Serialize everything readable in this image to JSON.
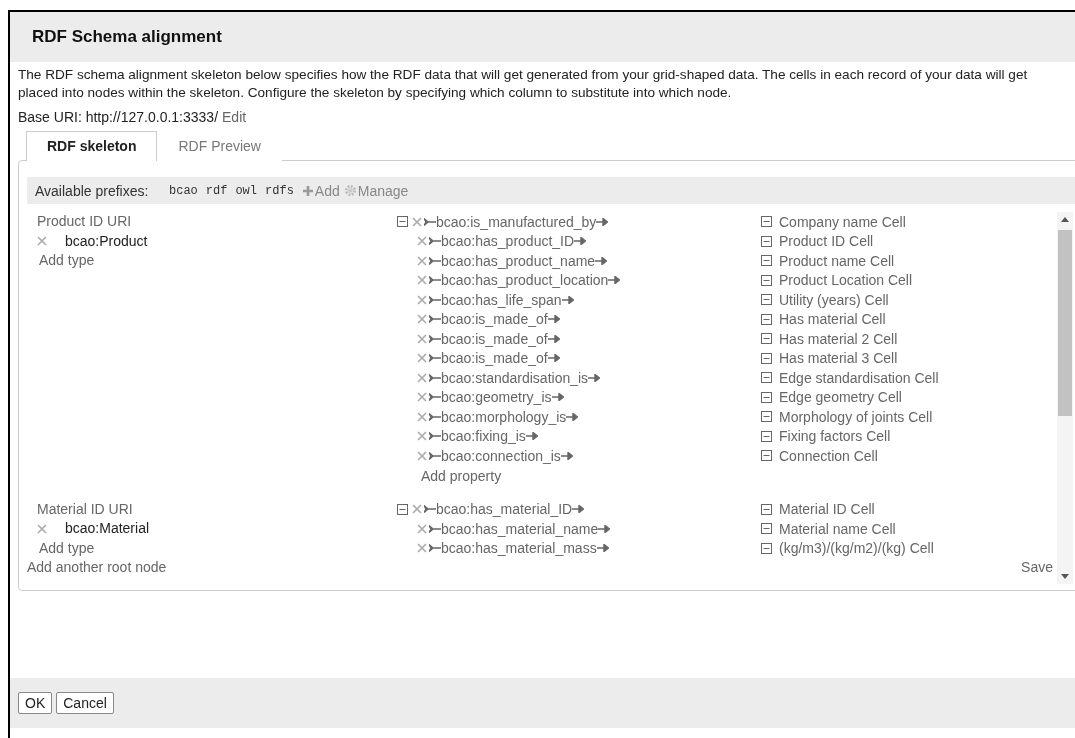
{
  "dialog": {
    "title": "RDF Schema alignment",
    "description": "The RDF schema alignment skeleton below specifies how the RDF data that will get generated from your grid-shaped data. The cells in each record of your data will get placed into nodes within the skeleton. Configure the skeleton by specifying which column to substitute into which node.",
    "base_uri": "Base URI: http://127.0.0.1:3333/",
    "edit_link": "Edit"
  },
  "tabs": [
    {
      "label": "RDF skeleton",
      "selected": true
    },
    {
      "label": "RDF Preview",
      "selected": false
    }
  ],
  "prefixes": {
    "label": "Available prefixes:",
    "items": [
      "bcao",
      "rdf",
      "owl",
      "rdfs"
    ],
    "add": "Add",
    "manage": "Manage"
  },
  "root_nodes": [
    {
      "column": "Product ID URI",
      "type": "bcao:Product",
      "add_type": "Add type",
      "expanded": true,
      "add_property": "Add property",
      "properties": [
        {
          "name": "bcao:is_manufactured_by",
          "target": "Company name Cell"
        },
        {
          "name": "bcao:has_product_ID",
          "target": "Product ID Cell"
        },
        {
          "name": "bcao:has_product_name",
          "target": "Product name Cell"
        },
        {
          "name": "bcao:has_product_location",
          "target": "Product Location Cell"
        },
        {
          "name": "bcao:has_life_span",
          "target": "Utility (years) Cell"
        },
        {
          "name": "bcao:is_made_of",
          "target": "Has material Cell"
        },
        {
          "name": "bcao:is_made_of",
          "target": "Has material 2 Cell"
        },
        {
          "name": "bcao:is_made_of",
          "target": "Has material 3 Cell"
        },
        {
          "name": "bcao:standardisation_is",
          "target": "Edge standardisation Cell"
        },
        {
          "name": "bcao:geometry_is",
          "target": "Edge geometry Cell"
        },
        {
          "name": "bcao:morphology_is",
          "target": "Morphology of joints Cell"
        },
        {
          "name": "bcao:fixing_is",
          "target": "Fixing factors Cell"
        },
        {
          "name": "bcao:connection_is",
          "target": "Connection Cell"
        }
      ]
    },
    {
      "column": "Material ID URI",
      "type": "bcao:Material",
      "add_type": "Add type",
      "expanded": true,
      "properties": [
        {
          "name": "bcao:has_material_ID",
          "target": "Material ID Cell"
        },
        {
          "name": "bcao:has_material_name",
          "target": "Material name Cell"
        },
        {
          "name": "bcao:has_material_mass",
          "target": "(kg/m3)/(kg/m2)/(kg) Cell"
        }
      ]
    }
  ],
  "add_root": "Add another root node",
  "save": "Save",
  "buttons": [
    "OK",
    "Cancel"
  ]
}
